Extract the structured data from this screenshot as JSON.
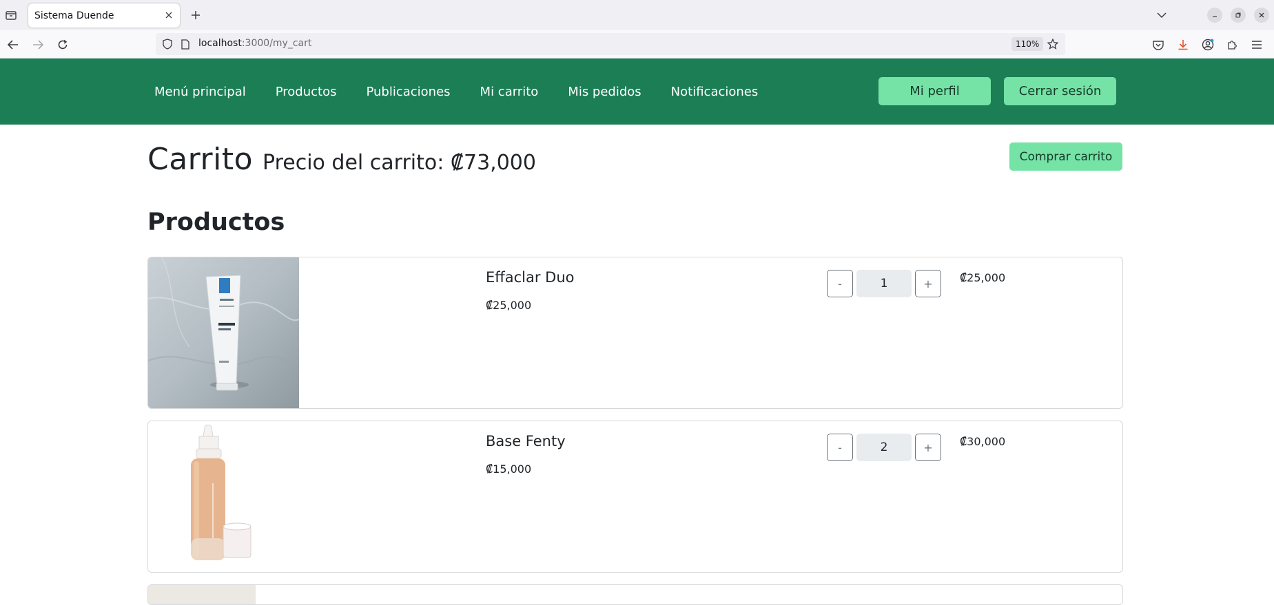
{
  "browser": {
    "tab_title": "Sistema Duende",
    "url_host": "localhost",
    "url_path": ":3000/my_cart",
    "zoom": "110%"
  },
  "nav": {
    "links": [
      "Menú principal",
      "Productos",
      "Publicaciones",
      "Mi carrito",
      "Mis pedidos",
      "Notificaciones"
    ],
    "profile_label": "Mi perfil",
    "logout_label": "Cerrar sesión"
  },
  "page": {
    "title": "Carrito",
    "cart_price": "Precio del carrito: ₡73,000",
    "buy_label": "Comprar carrito",
    "section_title": "Productos"
  },
  "products": [
    {
      "name": "Effaclar Duo",
      "unit_price": "₡25,000",
      "quantity": "1",
      "total": "₡25,000",
      "minus": "-",
      "plus": "+"
    },
    {
      "name": "Base Fenty",
      "unit_price": "₡15,000",
      "quantity": "2",
      "total": "₡30,000",
      "minus": "-",
      "plus": "+"
    }
  ],
  "colors": {
    "nav_bg": "#1b7e55",
    "accent_button": "#75e2a6"
  },
  "icons": {
    "tab_list": "tab-list-icon",
    "close_tab": "close-icon",
    "new_tab": "plus-icon",
    "back": "back-arrow-icon",
    "forward": "forward-arrow-icon",
    "reload": "reload-icon",
    "shield": "shield-icon",
    "page": "page-icon",
    "bookmark": "star-icon",
    "pocket": "pocket-icon",
    "download": "download-icon",
    "account": "account-icon",
    "extensions": "puzzle-icon",
    "menu": "hamburger-menu-icon"
  }
}
